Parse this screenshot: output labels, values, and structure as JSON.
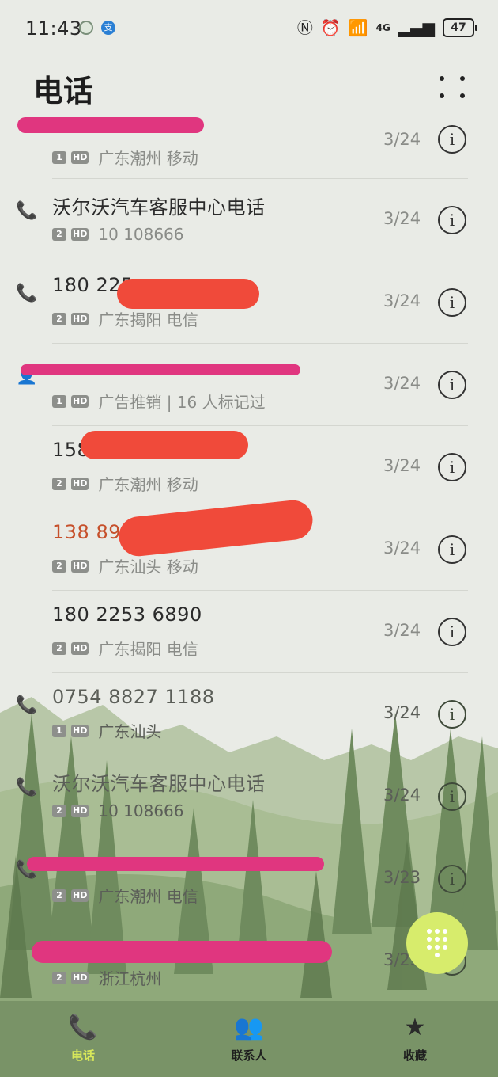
{
  "status_bar": {
    "time": "11:43",
    "network": "4G",
    "battery": "47"
  },
  "header": {
    "title": "电话"
  },
  "calls": [
    {
      "name": "",
      "sim": "1",
      "location": "广东潮州 移动",
      "date": "3/24",
      "type": "none",
      "missed": false
    },
    {
      "name": "沃尔沃汽车客服中心电话",
      "sim": "2",
      "location": "10 108666",
      "date": "3/24",
      "type": "outgoing",
      "missed": false
    },
    {
      "name": "180 225",
      "sim": "2",
      "location": "广东揭阳 电信",
      "date": "3/24",
      "type": "outgoing",
      "missed": false
    },
    {
      "name": "",
      "sim": "1",
      "location": "广告推销 | 16 人标记过",
      "date": "3/24",
      "type": "contact",
      "missed": true
    },
    {
      "name": "158",
      "sim": "2",
      "location": "广东潮州 移动",
      "date": "3/24",
      "type": "none",
      "missed": false
    },
    {
      "name": "138 899",
      "sim": "2",
      "location": "广东汕头 移动",
      "date": "3/24",
      "type": "none",
      "missed": true
    },
    {
      "name": "180 2253 6890",
      "sim": "2",
      "location": "广东揭阳 电信",
      "date": "3/24",
      "type": "none",
      "missed": false
    },
    {
      "name": "0754 8827 1188",
      "sim": "1",
      "location": "广东汕头",
      "date": "3/24",
      "type": "outgoing",
      "missed": false
    },
    {
      "name": "沃尔沃汽车客服中心电话",
      "sim": "2",
      "location": "10 108666",
      "date": "3/24",
      "type": "outgoing",
      "missed": false
    },
    {
      "name": "",
      "sim": "2",
      "location": "广东潮州 电信",
      "date": "3/23",
      "type": "outgoing",
      "missed": false
    },
    {
      "name": "",
      "sim": "2",
      "location": "浙江杭州",
      "date": "3/23",
      "type": "none",
      "missed": true
    }
  ],
  "labels": {
    "hd": "HD",
    "info": "i"
  },
  "bottom_nav": {
    "phone": "电话",
    "contacts": "联系人",
    "favorites": "收藏"
  },
  "icons": {
    "outgoing_call": "phone-outgoing-icon",
    "dialpad": "dialpad-icon",
    "more": "more-dots-icon"
  }
}
